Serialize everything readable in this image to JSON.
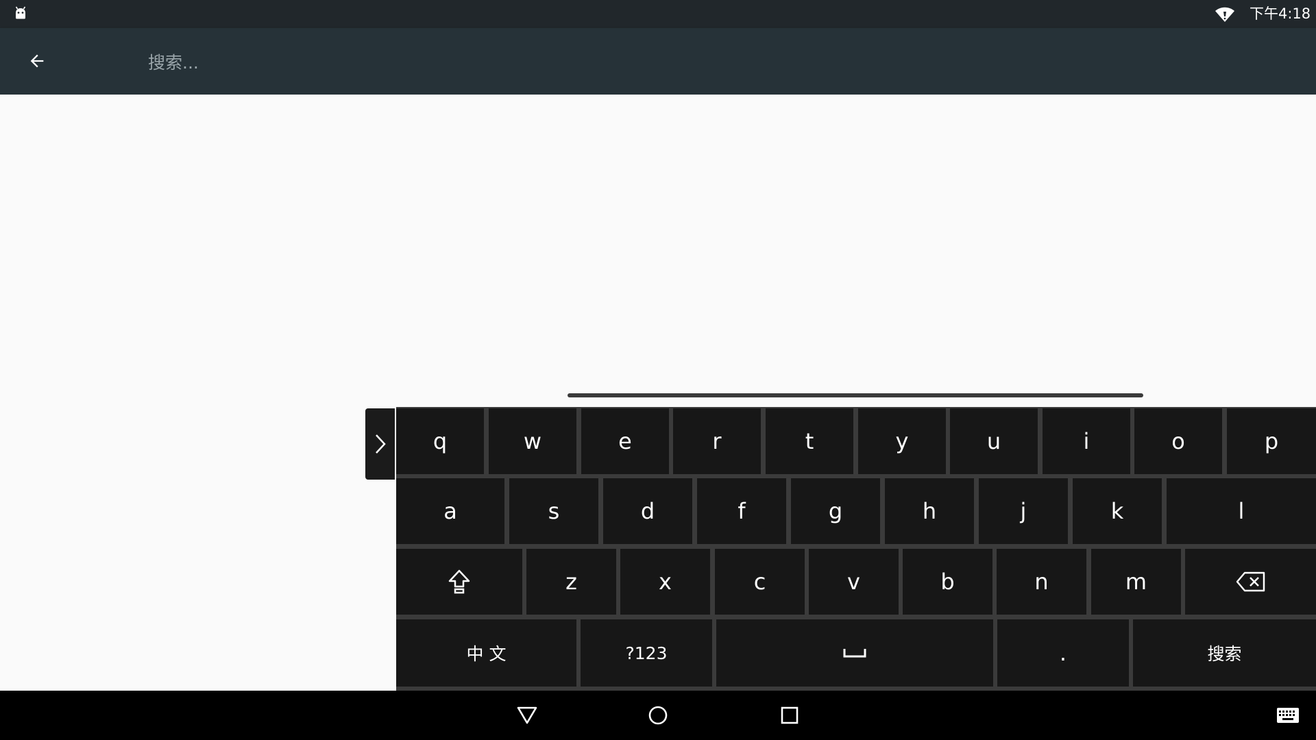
{
  "status_bar": {
    "time": "下午4:18",
    "icons": [
      "android-debug-icon",
      "wifi-icon"
    ]
  },
  "toolbar": {
    "back_icon": "arrow-left-icon",
    "search_placeholder": "搜索...",
    "search_value": ""
  },
  "keyboard": {
    "row1": [
      "q",
      "w",
      "e",
      "r",
      "t",
      "y",
      "u",
      "i",
      "o",
      "p"
    ],
    "row2": [
      "a",
      "s",
      "d",
      "f",
      "g",
      "h",
      "j",
      "k",
      "l"
    ],
    "row3": [
      "z",
      "x",
      "c",
      "v",
      "b",
      "n",
      "m"
    ],
    "row3_icons": {
      "shift": "shift-icon",
      "backspace": "backspace-icon"
    },
    "row4": {
      "lang": "中 文",
      "symbols": "?123",
      "space_icon": "space-icon",
      "period": ".",
      "action": "搜索"
    },
    "collapse_icon": "chevron-right-icon",
    "colors": {
      "key": "#171717",
      "gap": "#3b3b3b",
      "text": "#ffffff"
    }
  },
  "nav_bar": {
    "buttons": [
      "back-triangle-icon",
      "home-circle-icon",
      "recents-square-icon",
      "keyboard-switch-icon"
    ]
  },
  "colors": {
    "status_bar": "#21272b",
    "toolbar": "#263238",
    "background": "#fafafa"
  }
}
